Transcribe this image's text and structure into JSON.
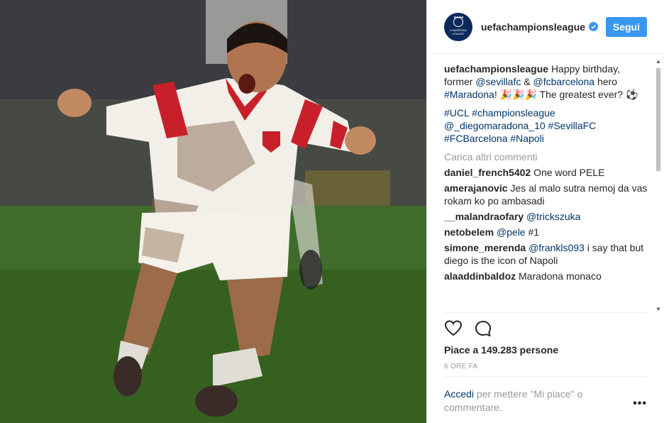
{
  "account": {
    "username": "uefachampionsleague",
    "follow_label": "Segui",
    "avatar_text": "CHAMPIONS LEAGUE",
    "brand_color": "#0b2a5b",
    "accent_color": "#3897f0"
  },
  "caption": {
    "user": "uefachampionsleague",
    "text_1": "Happy birthday, former ",
    "mention_1": "@sevillafc",
    "text_2": " & ",
    "mention_2": "@fcbarcelona",
    "text_3": " hero ",
    "hashtag_1": "#Maradona",
    "text_4": "! 🎉🎉🎉 The greatest ever? ⚽",
    "tags": [
      "#UCL",
      "#championsleague",
      "@_diegomaradona_10",
      "#SevillaFC",
      "#FCBarcelona",
      "#Napoli"
    ]
  },
  "load_more": "Carica altri commenti",
  "comments": [
    {
      "user": "daniel_french5402",
      "pre": "One word PELE",
      "mention": "",
      "post": ""
    },
    {
      "user": "amerajanovic",
      "pre": "Jes al malo sutra nemoj da vas rokam ko po ambasadi",
      "mention": "",
      "post": ""
    },
    {
      "user": "__malandraofary",
      "pre": "",
      "mention": "@trickszuka",
      "post": ""
    },
    {
      "user": "netobelem",
      "pre": "",
      "mention": "@pele",
      "post": " #1"
    },
    {
      "user": "simone_merenda",
      "pre": "",
      "mention": "@frankls093",
      "post": " i say that but diego is the icon of Napoli"
    },
    {
      "user": "alaaddinbaldoz",
      "pre": "Maradona monaco",
      "mention": "",
      "post": ""
    }
  ],
  "likes": "Piace a 149.283 persone",
  "time_ago": "6 ORE FA",
  "footer": {
    "login_link": "Accedi",
    "text": " per mettere \"Mi piace\" o commentare."
  },
  "icons": {
    "like": "heart-icon",
    "comment": "comment-icon",
    "more": "more-options-icon",
    "verified": "verified-badge-icon"
  }
}
